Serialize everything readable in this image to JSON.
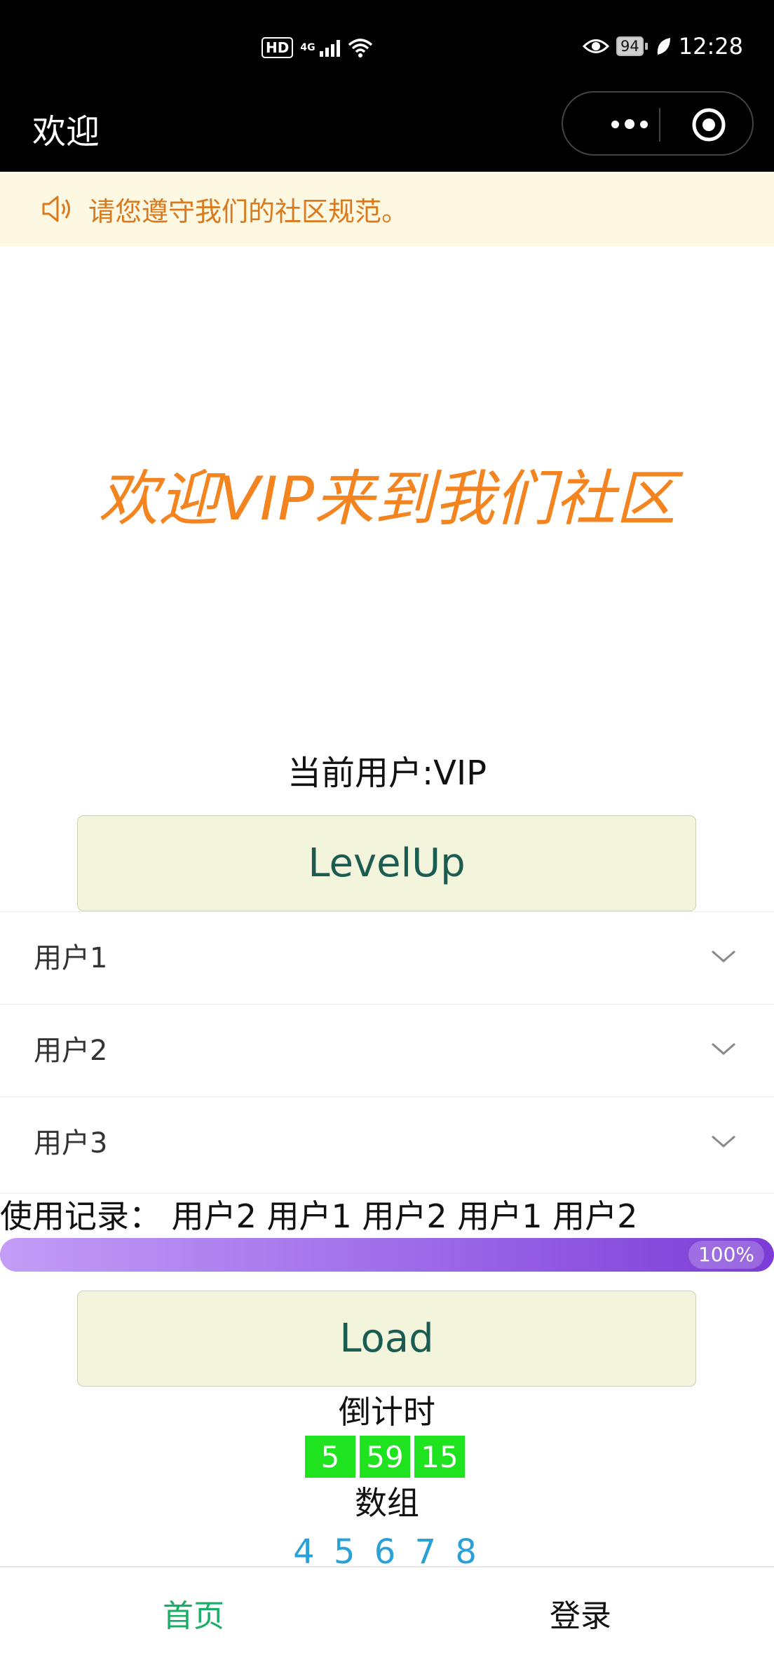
{
  "status_bar": {
    "hd": "HD",
    "network": "4G",
    "battery": "94",
    "time": "12:28"
  },
  "nav": {
    "title": "欢迎"
  },
  "notice": {
    "text": "请您遵守我们的社区规范。",
    "color": "#d97a1f",
    "background": "#fdf8e2"
  },
  "welcome": {
    "text": "欢迎VIP来到我们社区",
    "color": "#f3841f"
  },
  "current_user": {
    "text": "当前用户:VIP"
  },
  "buttons": {
    "level_up": "LevelUp",
    "load": "Load"
  },
  "collapse_items": [
    {
      "label": "用户1"
    },
    {
      "label": "用户2"
    },
    {
      "label": "用户3"
    }
  ],
  "history": {
    "text": "使用记录： 用户2 用户1 用户2 用户1 用户2"
  },
  "progress": {
    "percent": 100,
    "label": "100%"
  },
  "countdown": {
    "title": "倒计时",
    "hours": "5",
    "minutes": "59",
    "seconds": "15",
    "color": "#1ee31e"
  },
  "array": {
    "title": "数组",
    "values": "4 5 6 7 8",
    "color": "#2aa0d8"
  },
  "tabbar": {
    "tabs": [
      {
        "label": "首页",
        "active": true
      },
      {
        "label": "登录",
        "active": false
      }
    ],
    "active_color": "#19ad66"
  }
}
